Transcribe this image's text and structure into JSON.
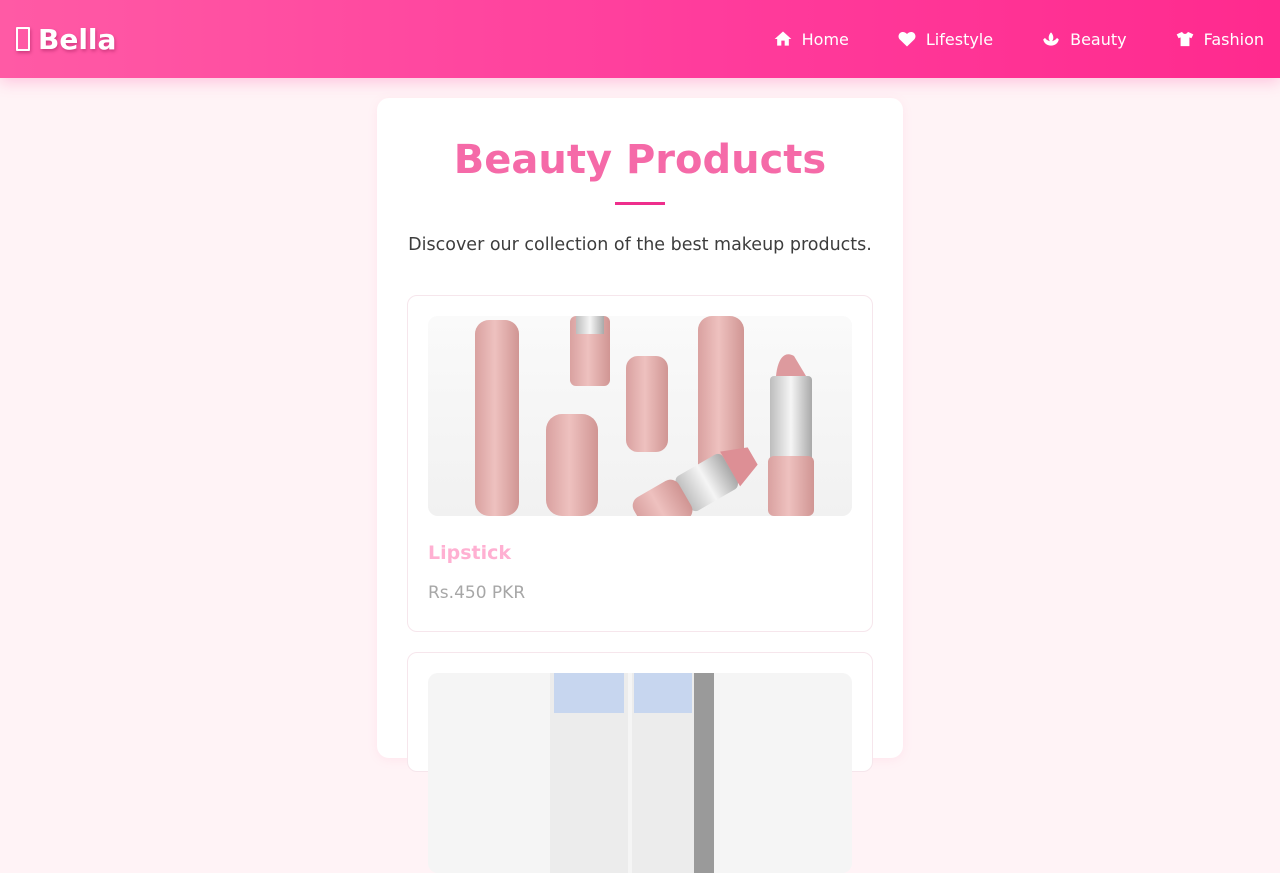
{
  "navbar": {
    "brand": "Bella",
    "brand_icon": "box-glyph-icon",
    "links": [
      {
        "label": "Home",
        "icon": "home-icon"
      },
      {
        "label": "Lifestyle",
        "icon": "heart-icon"
      },
      {
        "label": "Beauty",
        "icon": "spa-icon"
      },
      {
        "label": "Fashion",
        "icon": "tshirt-icon"
      }
    ],
    "gradient": [
      "#ff5aa5",
      "#ff2a8e"
    ]
  },
  "main": {
    "title": "Beauty Products",
    "subtitle": "Discover our collection of the best makeup products.",
    "products": [
      {
        "name": "Lipstick",
        "price": "Rs.450 PKR",
        "image": "lipstick-product-photo"
      },
      {
        "image": "primer-product-photo"
      }
    ]
  },
  "colors": {
    "page_background": "#fff3f6",
    "title": "#f56aa8",
    "accent": "#ee2f8c",
    "product_name": "#ffb0d2",
    "price": "#a7a7a7"
  }
}
